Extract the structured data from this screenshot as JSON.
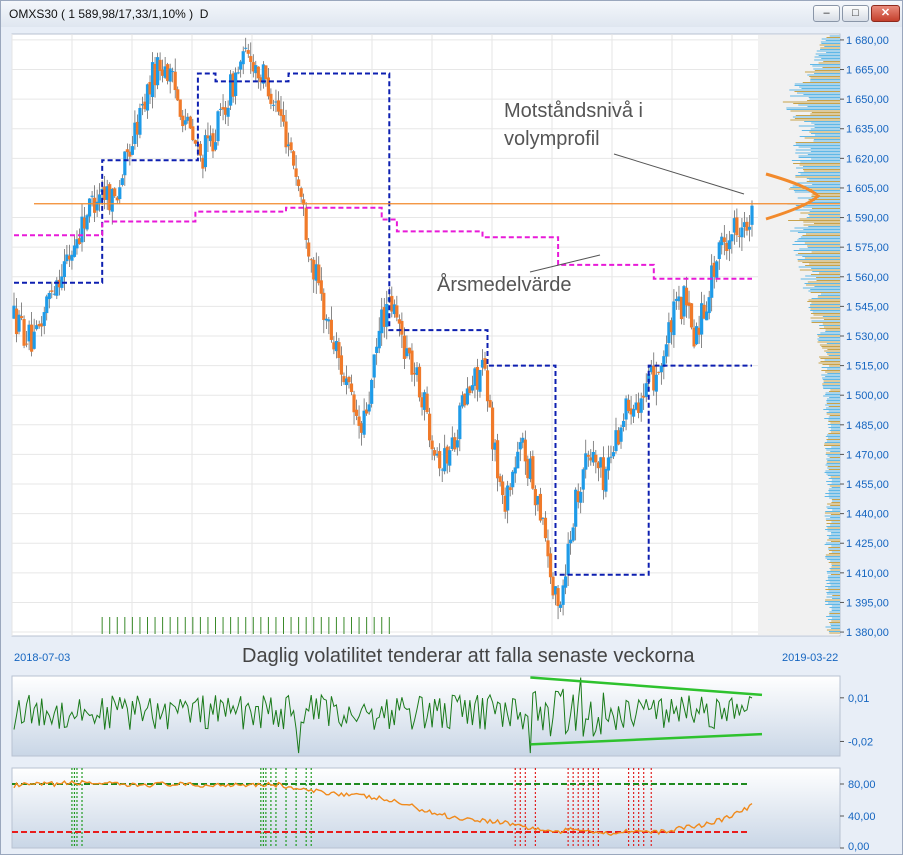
{
  "window": {
    "title": "OMXS30 ( 1 589,98/17,33/1,10% )  D",
    "buttons": {
      "minimize": "–",
      "maximize": "□",
      "close": "✕"
    }
  },
  "annotations": {
    "resistance": "Motståndsnivå i volymprofil",
    "yearly_average": "Årsmedelvärde",
    "volatility": "Daglig volatilitet tenderar att falla senaste veckorna"
  },
  "colors": {
    "up_candle": "#1e9be8",
    "down_candle": "#f07a2a",
    "blue_step": "#0d1fb0",
    "magenta_avg": "#e81ad8",
    "resistance_line": "#f28a2c",
    "volume_profile": "#c8a24a",
    "volume_profile_blue": "#5fb8e8",
    "oscillator_line": "#1a7a1a",
    "trend_lines": "#2ec22e",
    "rsi_line": "#f08a1c",
    "rsi_upper": "#1f8a1f",
    "rsi_lower": "#e81c1c",
    "axis_text": "#1565c0"
  },
  "chart_data": [
    {
      "type": "candlestick",
      "title": "OMXS30 ( 1 589,98/17,33/1,10% )  D",
      "x_range": [
        "2018-07-03",
        "2019-03-22"
      ],
      "x_tick_labels": [
        "2018-07-03",
        "2019-03-22"
      ],
      "yticks": [
        "1 680,00",
        "1 665,00",
        "1 650,00",
        "1 635,00",
        "1 620,00",
        "1 605,00",
        "1 590,00",
        "1 575,00",
        "1 560,00",
        "1 545,00",
        "1 530,00",
        "1 515,00",
        "1 500,00",
        "1 485,00",
        "1 470,00",
        "1 455,00",
        "1 440,00",
        "1 425,00",
        "1 410,00",
        "1 395,00",
        "1 380,00"
      ],
      "ylim": [
        1378,
        1683
      ],
      "price_path": [
        [
          0,
          1540
        ],
        [
          8,
          1525
        ],
        [
          15,
          1555
        ],
        [
          22,
          1570
        ],
        [
          28,
          1590
        ],
        [
          34,
          1605
        ],
        [
          40,
          1600
        ],
        [
          46,
          1625
        ],
        [
          52,
          1650
        ],
        [
          56,
          1665
        ],
        [
          60,
          1668
        ],
        [
          62,
          1660
        ],
        [
          66,
          1648
        ],
        [
          70,
          1632
        ],
        [
          74,
          1620
        ],
        [
          78,
          1628
        ],
        [
          82,
          1640
        ],
        [
          86,
          1655
        ],
        [
          90,
          1668
        ],
        [
          94,
          1672
        ],
        [
          98,
          1662
        ],
        [
          102,
          1655
        ],
        [
          106,
          1640
        ],
        [
          110,
          1625
        ],
        [
          114,
          1600
        ],
        [
          118,
          1570
        ],
        [
          122,
          1548
        ],
        [
          126,
          1530
        ],
        [
          130,
          1515
        ],
        [
          134,
          1495
        ],
        [
          138,
          1480
        ],
        [
          142,
          1505
        ],
        [
          146,
          1540
        ],
        [
          150,
          1545
        ],
        [
          154,
          1530
        ],
        [
          158,
          1515
        ],
        [
          162,
          1500
        ],
        [
          166,
          1480
        ],
        [
          170,
          1465
        ],
        [
          174,
          1475
        ],
        [
          178,
          1495
        ],
        [
          182,
          1505
        ],
        [
          186,
          1515
        ],
        [
          190,
          1480
        ],
        [
          194,
          1445
        ],
        [
          198,
          1460
        ],
        [
          202,
          1475
        ],
        [
          206,
          1455
        ],
        [
          210,
          1440
        ],
        [
          214,
          1400
        ],
        [
          216,
          1392
        ],
        [
          218,
          1405
        ],
        [
          222,
          1440
        ],
        [
          226,
          1465
        ],
        [
          230,
          1470
        ],
        [
          234,
          1458
        ],
        [
          238,
          1475
        ],
        [
          242,
          1490
        ],
        [
          246,
          1500
        ],
        [
          250,
          1498
        ],
        [
          254,
          1510
        ],
        [
          258,
          1520
        ],
        [
          262,
          1540
        ],
        [
          266,
          1548
        ],
        [
          270,
          1530
        ],
        [
          274,
          1545
        ],
        [
          278,
          1565
        ],
        [
          282,
          1578
        ],
        [
          286,
          1585
        ],
        [
          289,
          1590
        ],
        [
          291,
          1580
        ],
        [
          293,
          1590
        ]
      ],
      "num_bars": 294,
      "blue_step_levels": [
        [
          0,
          1557
        ],
        [
          35,
          1557
        ],
        [
          35,
          1619
        ],
        [
          73,
          1619
        ],
        [
          73,
          1663
        ],
        [
          80,
          1663
        ],
        [
          80,
          1659
        ],
        [
          109,
          1659
        ],
        [
          109,
          1663
        ],
        [
          149,
          1663
        ],
        [
          149,
          1533
        ],
        [
          188,
          1533
        ],
        [
          188,
          1515
        ],
        [
          215,
          1515
        ],
        [
          215,
          1409
        ],
        [
          252,
          1409
        ],
        [
          252,
          1515
        ],
        [
          293,
          1515
        ]
      ],
      "magenta_avg_levels": [
        [
          0,
          1581
        ],
        [
          35,
          1581
        ],
        [
          35,
          1588
        ],
        [
          72,
          1588
        ],
        [
          72,
          1593
        ],
        [
          108,
          1593
        ],
        [
          108,
          1595
        ],
        [
          146,
          1595
        ],
        [
          146,
          1589
        ],
        [
          152,
          1589
        ],
        [
          152,
          1583
        ],
        [
          186,
          1583
        ],
        [
          186,
          1580
        ],
        [
          216,
          1580
        ],
        [
          216,
          1566
        ],
        [
          254,
          1566
        ],
        [
          254,
          1559
        ],
        [
          293,
          1559
        ]
      ],
      "resistance_level": 1597,
      "volume_profile_peak": 1597,
      "volume_markers_range": [
        35,
        150
      ]
    },
    {
      "type": "line",
      "name": "daily_volatility_oscillator",
      "yticks": [
        "0,01",
        "-0,02"
      ],
      "ylim": [
        -0.03,
        0.025
      ],
      "trend_upper": [
        [
          205,
          0.024
        ],
        [
          293,
          0.012
        ]
      ],
      "trend_lower": [
        [
          205,
          -0.022
        ],
        [
          293,
          -0.015
        ]
      ]
    },
    {
      "type": "line",
      "name": "rsi",
      "yticks": [
        "80,00",
        "40,00",
        "0,00"
      ],
      "ylim": [
        0,
        100
      ],
      "upper_level": 80,
      "lower_level": 20,
      "rsi_path": [
        [
          0,
          78
        ],
        [
          15,
          80
        ],
        [
          30,
          82
        ],
        [
          45,
          78
        ],
        [
          60,
          80
        ],
        [
          75,
          78
        ],
        [
          90,
          80
        ],
        [
          105,
          79
        ],
        [
          115,
          72
        ],
        [
          130,
          68
        ],
        [
          145,
          62
        ],
        [
          155,
          55
        ],
        [
          165,
          45
        ],
        [
          175,
          38
        ],
        [
          185,
          35
        ],
        [
          195,
          32
        ],
        [
          205,
          25
        ],
        [
          215,
          20
        ],
        [
          225,
          24
        ],
        [
          235,
          18
        ],
        [
          245,
          22
        ],
        [
          255,
          19
        ],
        [
          265,
          25
        ],
        [
          275,
          30
        ],
        [
          285,
          40
        ],
        [
          293,
          53
        ]
      ],
      "green_marker_x": [
        23,
        24,
        25,
        27,
        98,
        99,
        100,
        102,
        104,
        108,
        112,
        116,
        118
      ],
      "red_marker_x": [
        199,
        201,
        203,
        207,
        220,
        222,
        224,
        226,
        228,
        230,
        232,
        244,
        246,
        248,
        250,
        253
      ]
    }
  ]
}
